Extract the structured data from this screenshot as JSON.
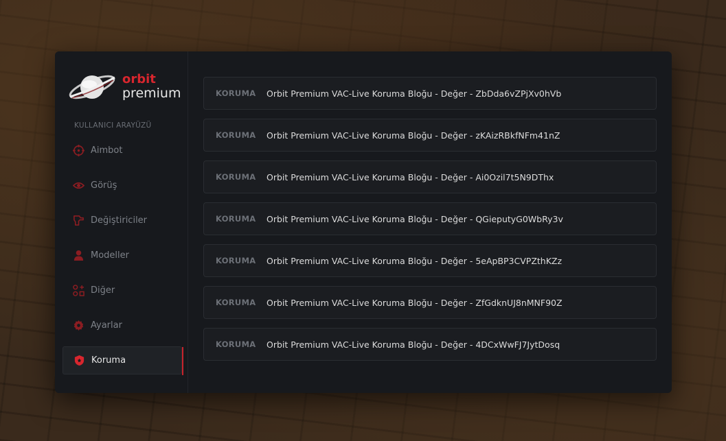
{
  "brand": {
    "line1": "orbit",
    "line2": "premium",
    "accent": "#d8262e"
  },
  "sidebar": {
    "section_label": "KULLANICI ARAYÜZÜ",
    "items": [
      {
        "label": "Aimbot",
        "icon": "crosshair-icon"
      },
      {
        "label": "Görüş",
        "icon": "eye-icon"
      },
      {
        "label": "Değiştiriciler",
        "icon": "gun-icon"
      },
      {
        "label": "Modeller",
        "icon": "user-icon"
      },
      {
        "label": "Diğer",
        "icon": "grid-plus-icon"
      },
      {
        "label": "Ayarlar",
        "icon": "gear-icon"
      },
      {
        "label": "Koruma",
        "icon": "shield-icon",
        "active": true
      }
    ]
  },
  "rows": [
    {
      "tag": "KORUMA",
      "text": "Orbit Premium VAC-Live Koruma Bloğu - Değer - ZbDda6vZPjXv0hVb"
    },
    {
      "tag": "KORUMA",
      "text": "Orbit Premium VAC-Live Koruma Bloğu - Değer - zKAizRBkfNFm41nZ"
    },
    {
      "tag": "KORUMA",
      "text": "Orbit Premium VAC-Live Koruma Bloğu - Değer - Ai0Ozil7t5N9DThx"
    },
    {
      "tag": "KORUMA",
      "text": "Orbit Premium VAC-Live Koruma Bloğu - Değer - QGieputyG0WbRy3v"
    },
    {
      "tag": "KORUMA",
      "text": "Orbit Premium VAC-Live Koruma Bloğu - Değer - 5eApBP3CVPZthKZz"
    },
    {
      "tag": "KORUMA",
      "text": "Orbit Premium VAC-Live Koruma Bloğu - Değer - ZfGdknUJ8nMNF90Z"
    },
    {
      "tag": "KORUMA",
      "text": "Orbit Premium VAC-Live Koruma Bloğu - Değer - 4DCxWwFJ7JytDosq"
    }
  ]
}
